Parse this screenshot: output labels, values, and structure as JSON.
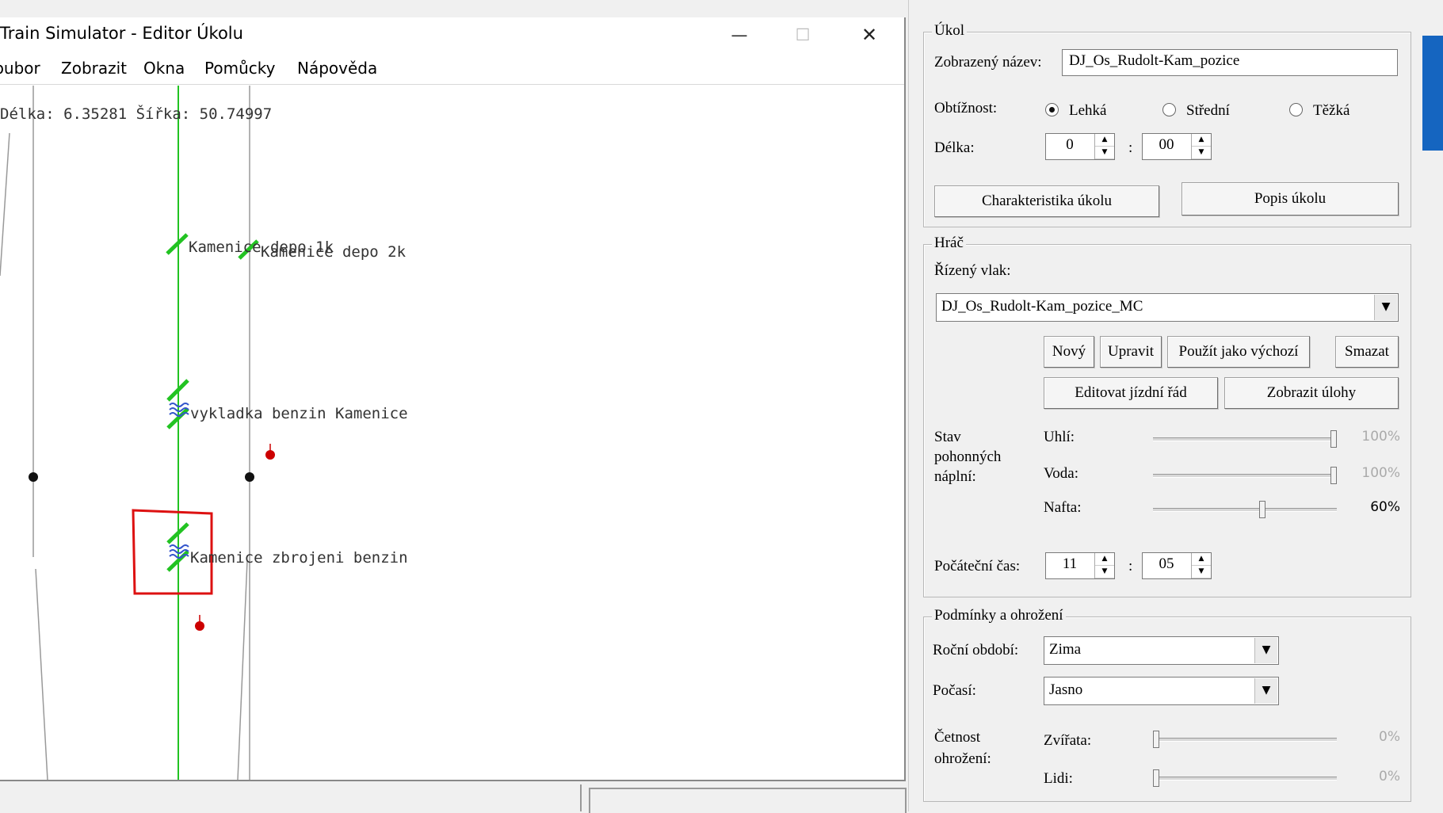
{
  "editor": {
    "title": "Train Simulator - Editor Úkolu",
    "window_controls": {
      "minimize": "—",
      "maximize": "☐",
      "close": "✕"
    },
    "menu": [
      "Soubor",
      "Zobrazit",
      "Okna",
      "Pomůcky",
      "Nápověda"
    ],
    "map": {
      "coords_text": "Délka: 6.35281 Šířka: 50.74997",
      "labels": {
        "depo_1k": "Kamenice depo 1k",
        "depo_2k": "Kamenice depo 2k",
        "vykladka": "vykladka benzin Kamenice",
        "zbrojeni": "Kamenice zbrojeni benzin"
      }
    }
  },
  "ukol": {
    "legend": "Úkol",
    "display_name_label": "Zobrazený název:",
    "display_name_value": "DJ_Os_Rudolt-Kam_pozice",
    "difficulty_label": "Obtížnost:",
    "difficulty_options": [
      "Lehká",
      "Střední",
      "Těžká"
    ],
    "difficulty_selected": "Lehká",
    "length_label": "Délka:",
    "length_hours": "0",
    "length_minutes": "00",
    "colon": ":",
    "characteristics_button": "Charakteristika úkolu",
    "description_button": "Popis úkolu"
  },
  "hrac": {
    "legend": "Hráč",
    "train_label": "Řízený vlak:",
    "train_value": "DJ_Os_Rudolt-Kam_pozice_MC",
    "buttons": {
      "new": "Nový",
      "edit": "Upravit",
      "use_default": "Použít jako výchozí",
      "delete": "Smazat",
      "edit_timetable": "Editovat jízdní řád",
      "show_tasks": "Zobrazit úlohy"
    },
    "fuel_label_lines": [
      "Stav",
      "pohonných",
      "náplní:"
    ],
    "fuel": [
      {
        "label": "Uhlí:",
        "value": 100,
        "text": "100%",
        "enabled": false
      },
      {
        "label": "Voda:",
        "value": 100,
        "text": "100%",
        "enabled": false
      },
      {
        "label": "Nafta:",
        "value": 60,
        "text": "60%",
        "enabled": true
      }
    ],
    "start_time_label": "Počáteční čas:",
    "start_hours": "11",
    "start_minutes": "05",
    "colon": ":"
  },
  "podminky": {
    "legend": "Podmínky a ohrožení",
    "season_label": "Roční období:",
    "season_value": "Zima",
    "weather_label": "Počasí:",
    "weather_value": "Jasno",
    "threat_label_lines": [
      "Četnost",
      "ohrožení:"
    ],
    "threats": [
      {
        "label": "Zvířata:",
        "value": 0,
        "text": "0%"
      },
      {
        "label": "Lidi:",
        "value": 0,
        "text": "0%"
      }
    ]
  },
  "colors": {
    "track_green": "#22c322",
    "selection_red": "#dd1111",
    "marker_red": "#cc0000",
    "signal_blue": "#3355cc",
    "accent_blue": "#1565c0"
  }
}
